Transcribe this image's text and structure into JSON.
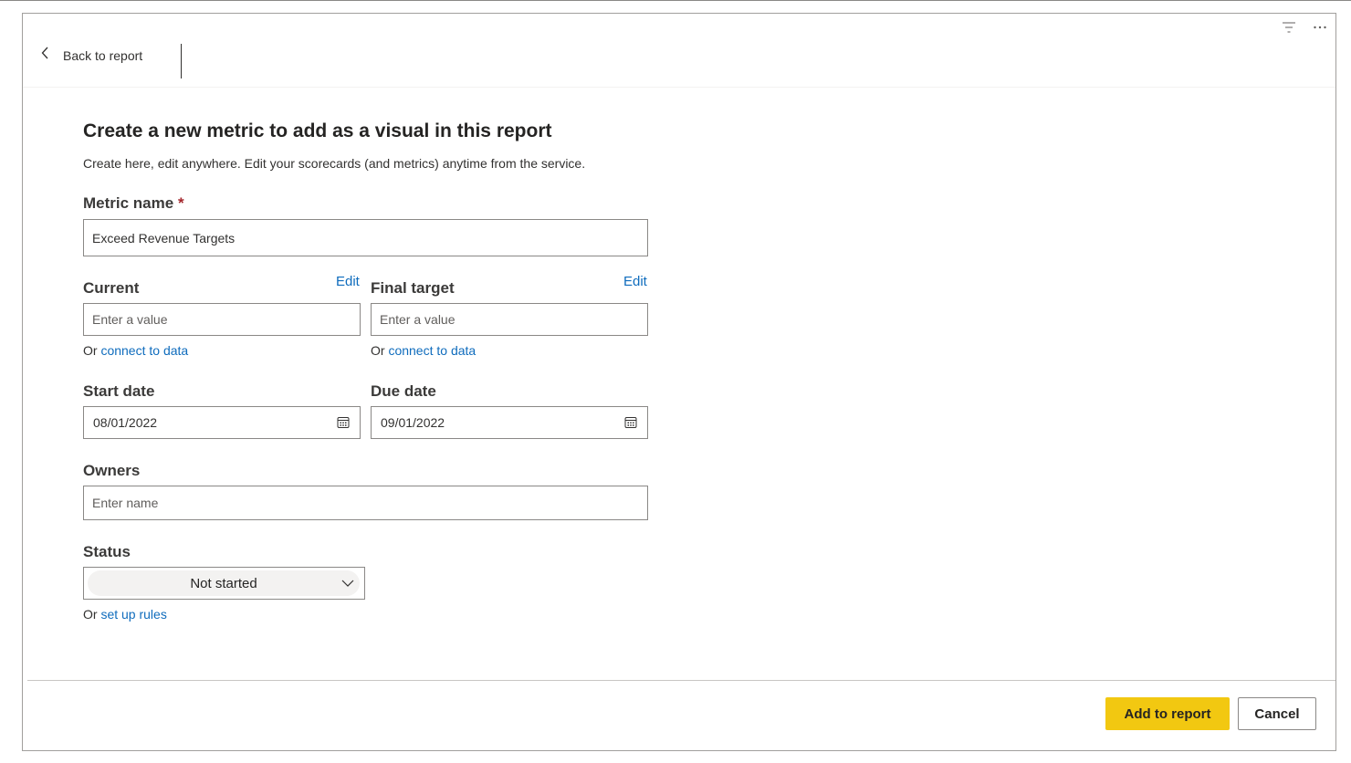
{
  "header": {
    "back_label": "Back to report",
    "icons": [
      "filter-icon",
      "more-options-icon"
    ]
  },
  "form": {
    "title": "Create a new metric to add as a visual in this report",
    "subtitle": "Create here, edit anywhere. Edit your scorecards (and metrics) anytime from the service.",
    "metric_name": {
      "label": "Metric name",
      "required_marker": "*",
      "value": "Exceed Revenue Targets"
    },
    "current": {
      "label": "Current",
      "edit_label": "Edit",
      "placeholder": "Enter a value",
      "or_text": "Or",
      "connect_link": "connect to data"
    },
    "final_target": {
      "label": "Final target",
      "edit_label": "Edit",
      "placeholder": "Enter a value",
      "or_text": "Or",
      "connect_link": "connect to data"
    },
    "start_date": {
      "label": "Start date",
      "value": "08/01/2022"
    },
    "due_date": {
      "label": "Due date",
      "value": "09/01/2022"
    },
    "owners": {
      "label": "Owners",
      "placeholder": "Enter name"
    },
    "status": {
      "label": "Status",
      "selected": "Not started",
      "or_text": "Or",
      "rules_link": "set up rules"
    }
  },
  "footer": {
    "primary_label": "Add to report",
    "secondary_label": "Cancel"
  },
  "colors": {
    "accent_yellow": "#f2c811",
    "link_blue": "#0f6cbd",
    "required_red": "#a4262c"
  }
}
